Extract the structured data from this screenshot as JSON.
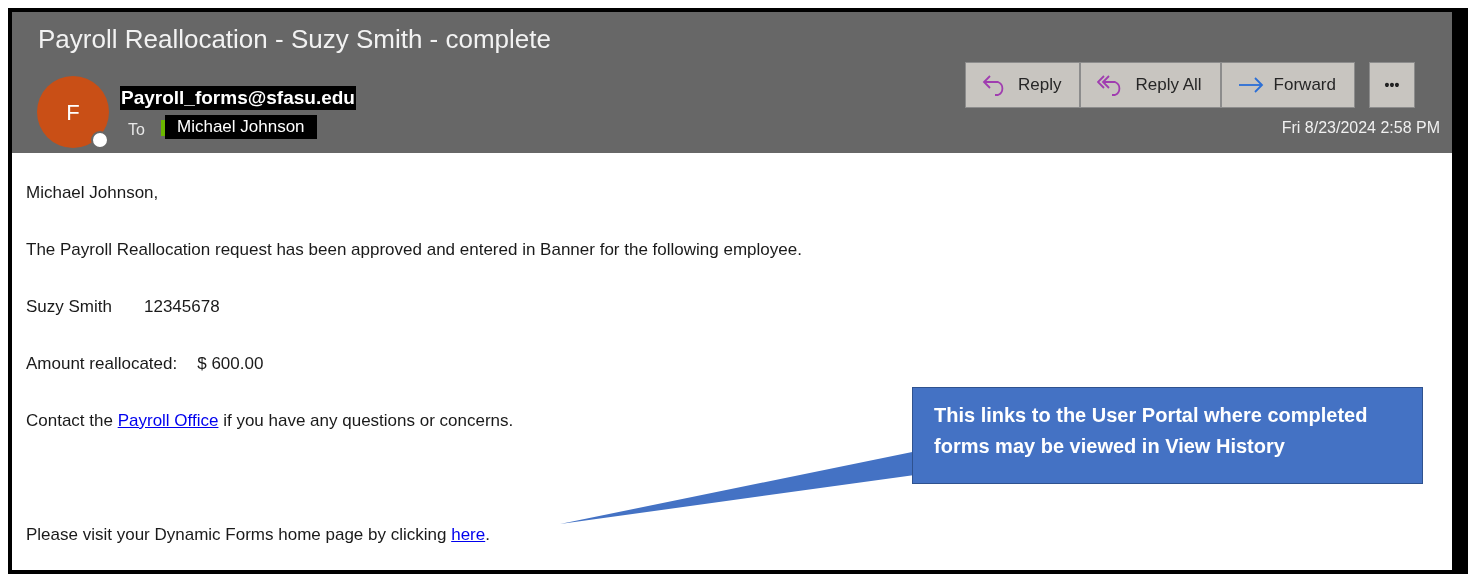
{
  "email": {
    "subject": "Payroll Reallocation - Suzy Smith - complete",
    "sender": {
      "initial": "F",
      "address": "Payroll_forms@sfasu.edu"
    },
    "to_label": "To",
    "recipient": "Michael Johnson",
    "actions": [
      {
        "kind": "reply",
        "label": "Reply"
      },
      {
        "kind": "reply-all",
        "label": "Reply All"
      },
      {
        "kind": "forward",
        "label": "Forward"
      },
      {
        "kind": "more",
        "label": "•••"
      }
    ],
    "date": "Fri 8/23/2024 2:58 PM",
    "body": [
      {
        "kind": "text",
        "text": "Michael Johnson,"
      },
      {
        "kind": "text",
        "text": "The Payroll Reallocation request has been approved and entered in Banner for the following employee."
      },
      {
        "kind": "pair",
        "label": "Suzy Smith",
        "value": "12345678"
      },
      {
        "kind": "pair",
        "label": "Amount reallocated:",
        "value": "$ 600.00"
      },
      {
        "kind": "link",
        "before": "Contact the ",
        "link": "Payroll Office",
        "after": " if you have any questions or concerns."
      },
      {
        "kind": "spacer"
      },
      {
        "kind": "link",
        "before": "Please visit your Dynamic Forms home page by clicking ",
        "link": "here",
        "after": "."
      }
    ]
  },
  "callout": {
    "text": "This links to the User Portal where completed forms may be viewed in View History"
  }
}
